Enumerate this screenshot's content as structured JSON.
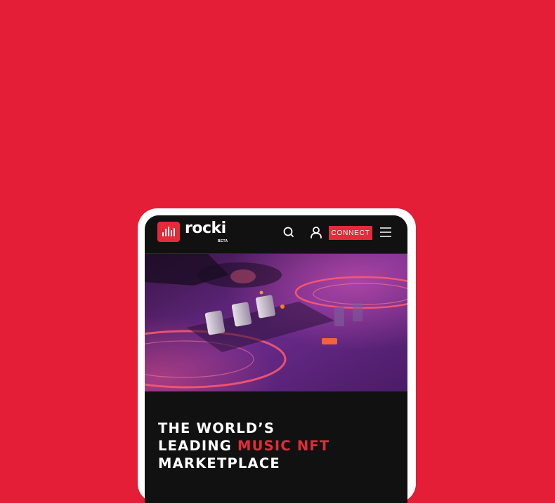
{
  "brand": {
    "name": "rocki",
    "badge": "BETA",
    "accent_color": "#E32B3A",
    "background_color": "#E31E36"
  },
  "nav": {
    "search_icon": "search-icon",
    "account_icon": "user-icon",
    "connect_label": "CONNECT",
    "menu_icon": "hamburger-menu-icon"
  },
  "hero": {
    "image": "dj-turntable-mixer-photo"
  },
  "headline": {
    "line1": "THE WORLD’S",
    "line2_prefix": "LEADING ",
    "line2_accent": "MUSIC NFT",
    "line3": "MARKETPLACE"
  }
}
